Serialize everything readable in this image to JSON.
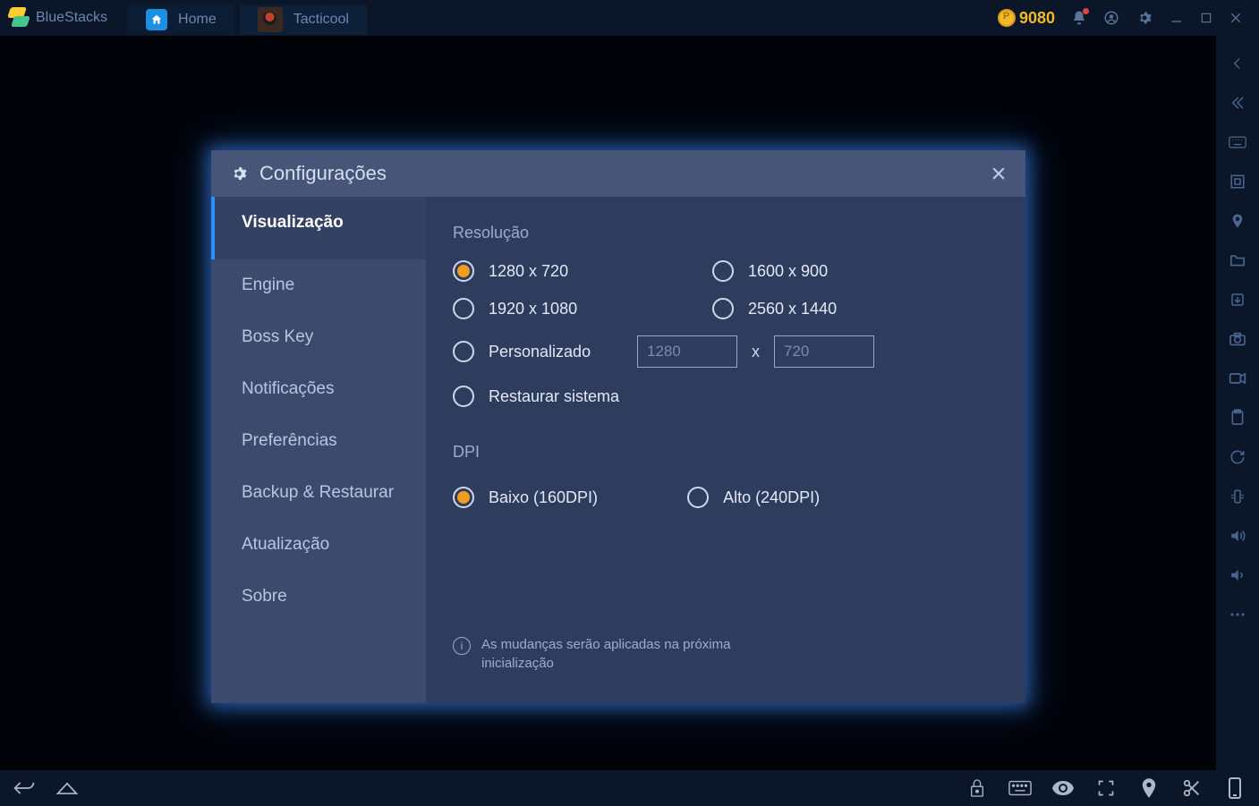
{
  "topbar": {
    "brand": "BlueStacks",
    "tabs": [
      {
        "label": "Home"
      },
      {
        "label": "Tacticool"
      }
    ],
    "coins": "9080"
  },
  "modal": {
    "title": "Configurações",
    "sidebar": [
      "Visualização",
      "Engine",
      "Boss Key",
      "Notificações",
      "Preferências",
      "Backup & Restaurar",
      "Atualização",
      "Sobre"
    ],
    "resolution": {
      "label": "Resolução",
      "options": [
        "1280 x 720",
        "1600 x 900",
        "1920 x 1080",
        "2560 x 1440"
      ],
      "custom_label": "Personalizado",
      "custom_w_ph": "1280",
      "custom_sep": "x",
      "custom_h_ph": "720",
      "restore_label": "Restaurar sistema"
    },
    "dpi": {
      "label": "DPI",
      "low": "Baixo (160DPI)",
      "high": "Alto (240DPI)"
    },
    "note": "As mudanças serão aplicadas na próxima inicialização"
  }
}
